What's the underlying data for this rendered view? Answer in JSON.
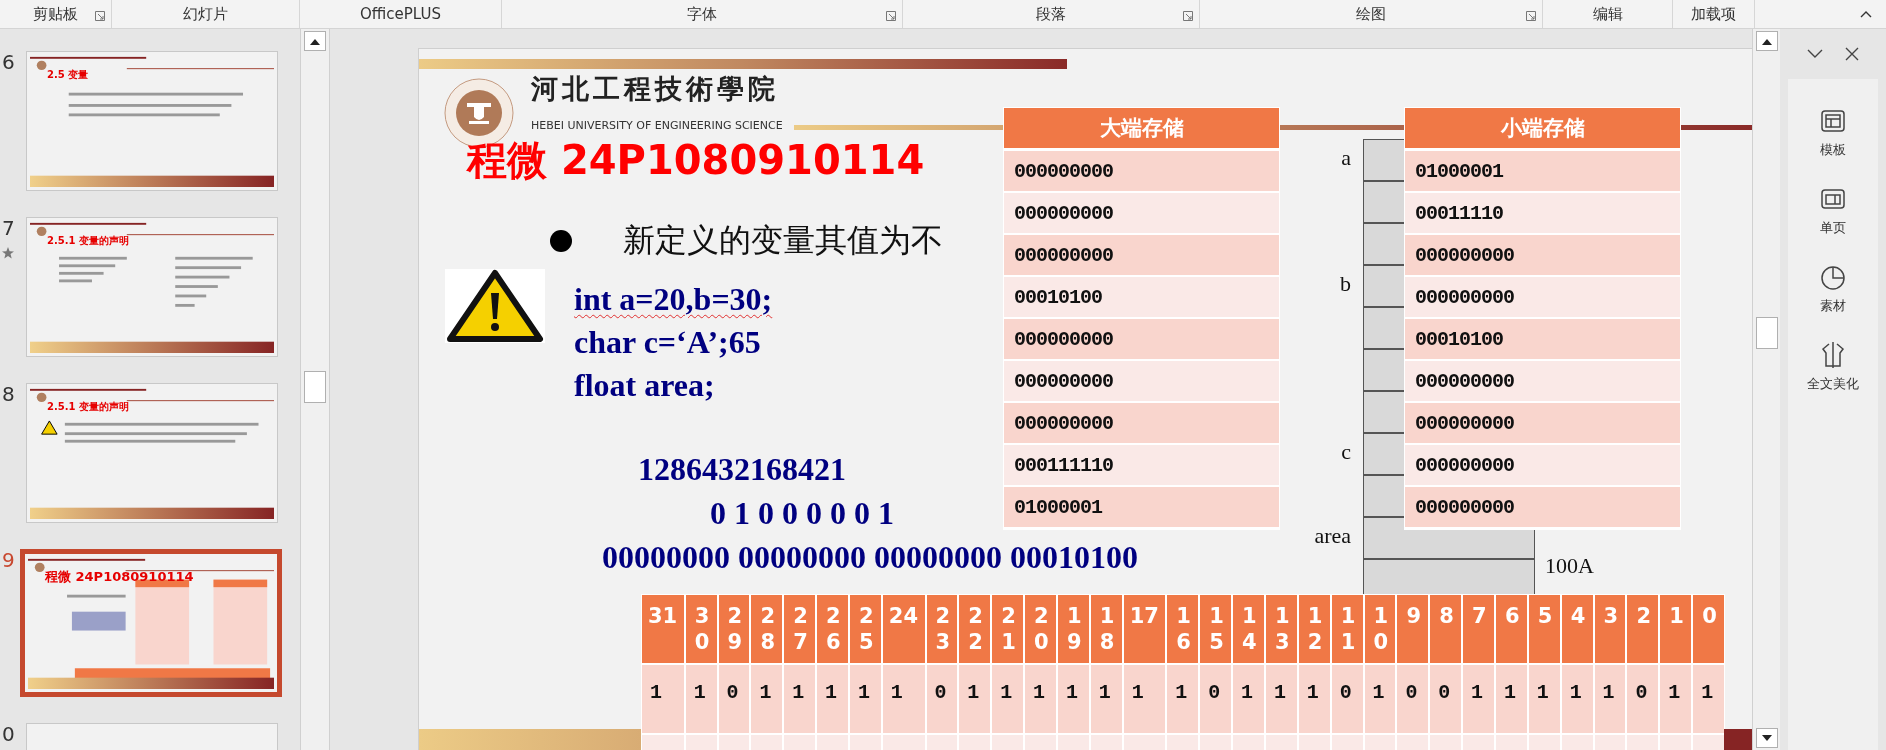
{
  "ribbon_groups": [
    {
      "label": "剪贴板",
      "launcher": true
    },
    {
      "label": "幻灯片",
      "launcher": false
    },
    {
      "label": "OfficePLUS",
      "launcher": false
    },
    {
      "label": "字体",
      "launcher": true
    },
    {
      "label": "段落",
      "launcher": true
    },
    {
      "label": "绘图",
      "launcher": true
    },
    {
      "label": "编辑",
      "launcher": false
    },
    {
      "label": "加载项",
      "launcher": false
    }
  ],
  "thumbnails": [
    {
      "number": "6",
      "title": "2.5  变量",
      "kind": "text",
      "selected": false,
      "starred": false
    },
    {
      "number": "7",
      "title": "2.5.1  变量的声明",
      "kind": "columns",
      "selected": false,
      "starred": true
    },
    {
      "number": "8",
      "title": "2.5.1  变量的声明",
      "kind": "warning",
      "selected": false,
      "starred": false
    },
    {
      "number": "9",
      "title": "程微 24P1080910114",
      "kind": "tables",
      "selected": true,
      "starred": false
    },
    {
      "number": "0",
      "kind": "header",
      "selected": false,
      "starred": false
    }
  ],
  "slide": {
    "university_name": "河北工程技術學院",
    "university_name_en": "HEBEI UNIVERSITY OF ENGINEERING SCIENCE",
    "title": "程微 24P1080910114",
    "bullet": "新定义的变量其值为不",
    "code_lines": [
      {
        "text": "int a=20,b=30;",
        "misspelled": true
      },
      {
        "text": "char c=‘A’;65",
        "misspelled": false
      },
      {
        "text": "float area;",
        "misspelled": false
      }
    ],
    "weights": "1286432168421",
    "char_bits": "0 1 0 0 0 0 0 1",
    "int_bits": "00000000 00000000 00000000 00010100",
    "big_endian": {
      "header": "大端存储",
      "rows": [
        "000000000",
        "000000000",
        "000000000",
        "00010100",
        "000000000",
        "000000000",
        "000000000",
        "000111110",
        "01000001"
      ]
    },
    "little_endian": {
      "header": "小端存储",
      "rows": [
        "01000001",
        "00011110",
        "000000000",
        "000000000",
        "00010100",
        "000000000",
        "000000000",
        "000000000",
        "000000000"
      ]
    },
    "memory_labels": [
      "a",
      "b",
      "c",
      "area"
    ],
    "memory_address": "100A",
    "bit_table": {
      "columns": [
        {
          "label": "31",
          "wide": true
        },
        {
          "label": "30",
          "wide": false
        },
        {
          "label": "29",
          "wide": false
        },
        {
          "label": "28",
          "wide": false
        },
        {
          "label": "27",
          "wide": false
        },
        {
          "label": "26",
          "wide": false
        },
        {
          "label": "25",
          "wide": false
        },
        {
          "label": "24",
          "wide": true
        },
        {
          "label": "23",
          "wide": false
        },
        {
          "label": "22",
          "wide": false
        },
        {
          "label": "21",
          "wide": false
        },
        {
          "label": "20",
          "wide": false
        },
        {
          "label": "19",
          "wide": false
        },
        {
          "label": "18",
          "wide": false
        },
        {
          "label": "17",
          "wide": true
        },
        {
          "label": "16",
          "wide": false
        },
        {
          "label": "15",
          "wide": false
        },
        {
          "label": "14",
          "wide": false
        },
        {
          "label": "13",
          "wide": false
        },
        {
          "label": "12",
          "wide": false
        },
        {
          "label": "11",
          "wide": false
        },
        {
          "label": "10",
          "wide": false
        },
        {
          "label": "9",
          "wide": false
        },
        {
          "label": "8",
          "wide": false
        },
        {
          "label": "7",
          "wide": false
        },
        {
          "label": "6",
          "wide": false
        },
        {
          "label": "5",
          "wide": false
        },
        {
          "label": "4",
          "wide": false
        },
        {
          "label": "3",
          "wide": false
        },
        {
          "label": "2",
          "wide": false
        },
        {
          "label": "1",
          "wide": false
        },
        {
          "label": "0",
          "wide": false
        }
      ],
      "values": [
        "1",
        "1",
        "0",
        "1",
        "1",
        "1",
        "1",
        "1",
        "0",
        "1",
        "1",
        "1",
        "1",
        "1",
        "1",
        "1",
        "0",
        "1",
        "1",
        "1",
        "0",
        "1",
        "0",
        "0",
        "1",
        "1",
        "1",
        "1",
        "1",
        "0",
        "1",
        "1"
      ]
    }
  },
  "side_panel": {
    "items": [
      {
        "label": "模板"
      },
      {
        "label": "单页"
      },
      {
        "label": "素材"
      },
      {
        "label": "全文美化"
      }
    ]
  }
}
